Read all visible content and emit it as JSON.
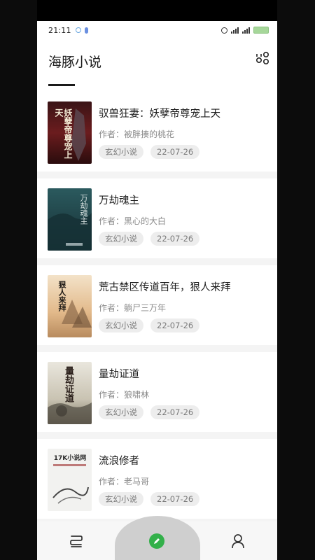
{
  "status": {
    "time": "21:11"
  },
  "app": {
    "title": "海豚小说"
  },
  "books": [
    {
      "title": "驭兽狂妻：妖孽帝尊宠上天",
      "author": "作者：被胖揍的桃花",
      "genre": "玄幻小说",
      "date": "22-07-26",
      "cover": "dark-red"
    },
    {
      "title": "万劫魂主",
      "author": "作者：黑心的大白",
      "genre": "玄幻小说",
      "date": "22-07-26",
      "cover": "teal"
    },
    {
      "title": "荒古禁区传道百年，狠人来拜",
      "author": "作者：躺尸三万年",
      "genre": "玄幻小说",
      "date": "22-07-26",
      "cover": "sunset"
    },
    {
      "title": "量劫证道",
      "author": "作者：狼啸林",
      "genre": "玄幻小说",
      "date": "22-07-26",
      "cover": "ink"
    },
    {
      "title": "流浪修者",
      "author": "作者：老马哥",
      "genre": "玄幻小说",
      "date": "22-07-26",
      "cover": "white"
    }
  ],
  "cover_text": {
    "b1": "妖孽帝尊宠上天",
    "b2": "万劫魂主",
    "b3": "狠人来拜",
    "b4": "量劫证道",
    "b5": "17K小说网"
  },
  "colors": {
    "accent": "#33b04a",
    "background": "#f4f4f4",
    "card": "#ffffff",
    "tag_bg": "#ededed"
  },
  "nav": {
    "left_icon": "bookshelf-icon",
    "center_icon": "pencil-icon",
    "right_icon": "profile-icon"
  }
}
